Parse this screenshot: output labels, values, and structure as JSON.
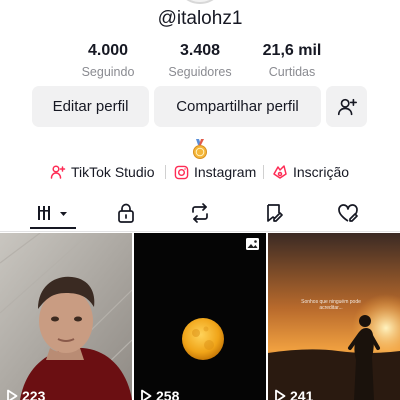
{
  "profile": {
    "username": "@italohz1"
  },
  "stats": [
    {
      "value": "4.000",
      "label": "Seguindo"
    },
    {
      "value": "3.408",
      "label": "Seguidores"
    },
    {
      "value": "21,6 mil",
      "label": "Curtidas"
    }
  ],
  "actions": {
    "edit_label": "Editar perfil",
    "share_label": "Compartilhar perfil",
    "add_friend_icon": "add-friend-icon"
  },
  "links": [
    {
      "label": "TikTok Studio",
      "icon": "tiktok-studio-icon",
      "color": "#fe2c55"
    },
    {
      "label": "Instagram",
      "icon": "instagram-icon",
      "color": "#fe2c55"
    },
    {
      "label": "Inscrição",
      "icon": "subscription-icon",
      "color": "#fe2c55"
    }
  ],
  "tabs": [
    {
      "icon": "videos-grid-icon",
      "active": true
    },
    {
      "icon": "lock-icon",
      "active": false
    },
    {
      "icon": "repost-icon",
      "active": false
    },
    {
      "icon": "bookmark-icon",
      "active": false
    },
    {
      "icon": "liked-heart-icon",
      "active": false
    }
  ],
  "videos": [
    {
      "views": "223"
    },
    {
      "views": "258",
      "badge_icon": "photo-icon"
    },
    {
      "views": "241",
      "caption": "Sonhos que ninguém pode acreditar..."
    }
  ],
  "colors": {
    "text": "#161823",
    "muted": "#8a8b91",
    "button_bg": "#f1f1f2",
    "accent": "#fe2c55"
  }
}
